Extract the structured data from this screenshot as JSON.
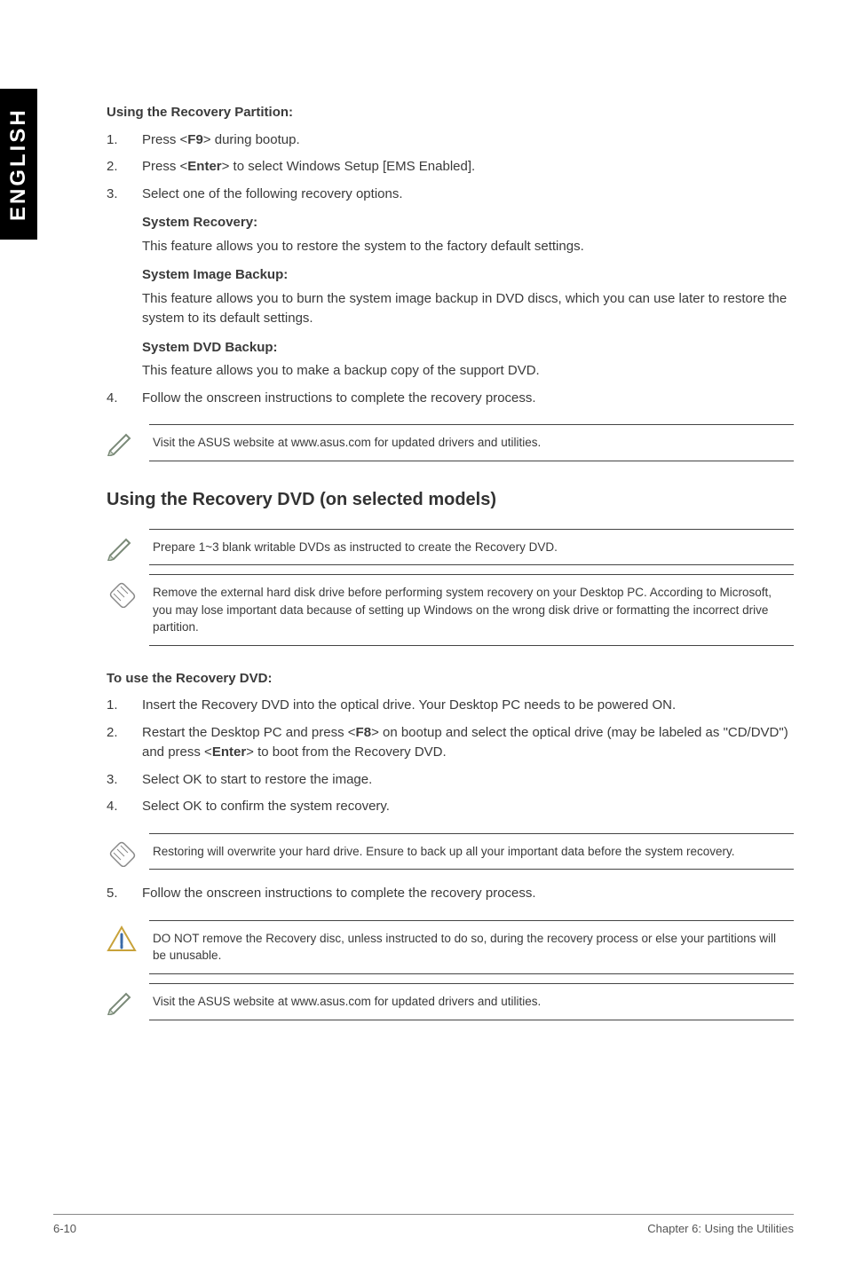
{
  "sideTab": "ENGLISH",
  "partition": {
    "heading": "Using the Recovery Partition:",
    "steps": {
      "s1_a": "Press <",
      "s1_key": "F9",
      "s1_b": "> during bootup.",
      "s2_a": "Press <",
      "s2_key": "Enter",
      "s2_b": "> to select Windows Setup [EMS Enabled].",
      "s3": "Select one of the following recovery options.",
      "sysRecovery": {
        "title": "System Recovery:",
        "body": "This feature allows you to restore the system to the factory default settings."
      },
      "imgBackup": {
        "title": "System Image Backup:",
        "body": "This feature allows you to burn the system image backup in DVD discs, which you can use later to restore the system to its default settings."
      },
      "dvdBackup": {
        "title": "System DVD Backup:",
        "body": "This feature allows you to make a backup copy of the support DVD."
      },
      "s4": "Follow the onscreen instructions to complete the recovery process."
    },
    "note": "Visit the ASUS website at www.asus.com for updated drivers and utilities."
  },
  "recoveryDvd": {
    "heading": "Using the Recovery DVD (on selected models)",
    "note1": "Prepare 1~3 blank writable DVDs as instructed to create the Recovery DVD.",
    "note2": "Remove the external hard disk drive before performing system recovery on your Desktop PC. According to Microsoft, you may lose important data because of setting up Windows on the wrong disk drive or formatting the incorrect drive partition.",
    "subhead": "To use the Recovery DVD:",
    "steps": {
      "s1": "Insert the Recovery DVD into the optical drive. Your Desktop PC needs to be powered ON.",
      "s2_a": "Restart the Desktop PC and press <",
      "s2_k1": "F8",
      "s2_b": "> on bootup and select the optical drive (may be labeled as \"CD/DVD\") and press <",
      "s2_k2": "Enter",
      "s2_c": "> to boot from the Recovery DVD.",
      "s3": "Select OK to start to restore the image.",
      "s4": "Select OK to confirm the system recovery."
    },
    "note3": "Restoring will overwrite your hard drive. Ensure to back up all your important data before the system recovery.",
    "s5": "Follow the onscreen instructions to complete the recovery process.",
    "note4": "DO NOT remove the Recovery disc, unless instructed to do so, during the recovery process or else your partitions will be unusable.",
    "note5": "Visit the ASUS website at www.asus.com for updated drivers and utilities."
  },
  "footer": {
    "left": "6-10",
    "right": "Chapter 6: Using the Utilities"
  },
  "nums": {
    "n1": "1.",
    "n2": "2.",
    "n3": "3.",
    "n4": "4.",
    "n5": "5."
  }
}
